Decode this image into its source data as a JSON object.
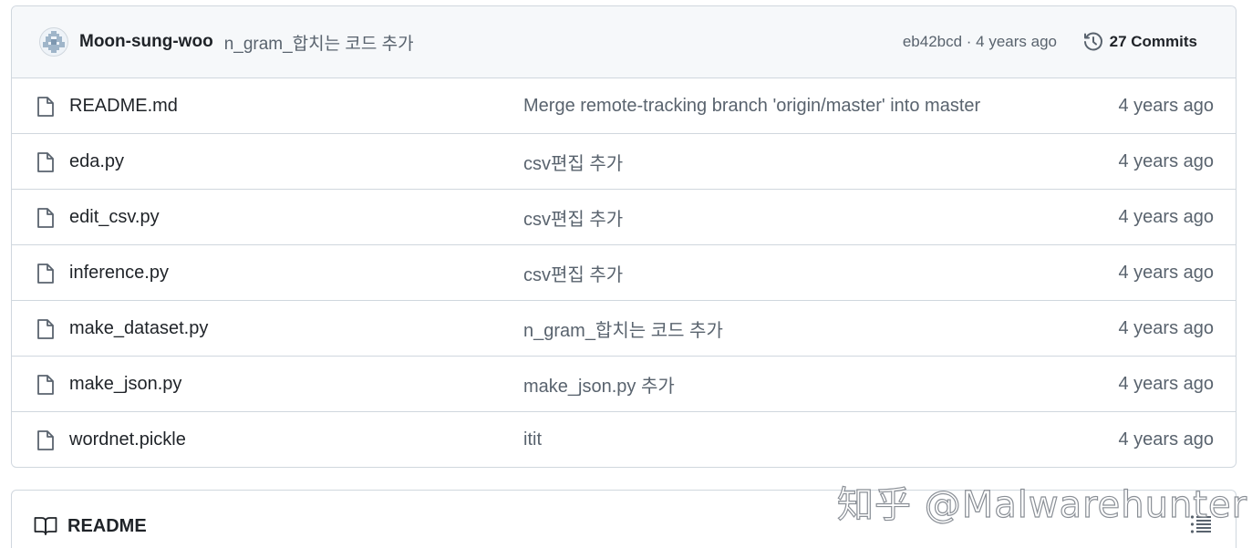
{
  "latest_commit": {
    "author": "Moon-sung-woo",
    "message": "n_gram_합치는 코드 추가",
    "meta": "eb42bcd · 4 years ago",
    "commits_label": "27 Commits",
    "avatar_icon": "identicon-avatar",
    "history_icon": "history-clock-icon"
  },
  "files": [
    {
      "name": "README.md",
      "message": "Merge remote-tracking branch 'origin/master' into master",
      "date": "4 years ago",
      "icon": "file-icon"
    },
    {
      "name": "eda.py",
      "message": "csv편집 추가",
      "date": "4 years ago",
      "icon": "file-icon"
    },
    {
      "name": "edit_csv.py",
      "message": "csv편집 추가",
      "date": "4 years ago",
      "icon": "file-icon"
    },
    {
      "name": "inference.py",
      "message": "csv편집 추가",
      "date": "4 years ago",
      "icon": "file-icon"
    },
    {
      "name": "make_dataset.py",
      "message": "n_gram_합치는 코드 추가",
      "date": "4 years ago",
      "icon": "file-icon"
    },
    {
      "name": "make_json.py",
      "message": "make_json.py 추가",
      "date": "4 years ago",
      "icon": "file-icon"
    },
    {
      "name": "wordnet.pickle",
      "message": "itit",
      "date": "4 years ago",
      "icon": "file-icon"
    }
  ],
  "readme": {
    "title": "README",
    "book_icon": "book-icon",
    "outline_icon": "list-outline-icon"
  },
  "watermark": "知乎 @Malwarehunter",
  "colors": {
    "border": "#d0d7de",
    "header_bg": "#f6f8fa",
    "text": "#1f2328",
    "muted": "#59636e"
  }
}
